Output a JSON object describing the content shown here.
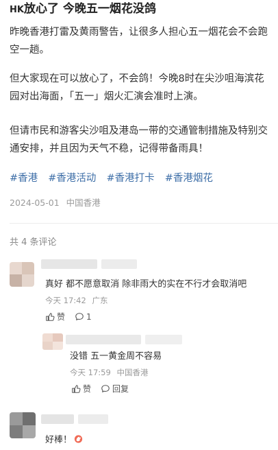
{
  "post": {
    "title_prefix": "HK",
    "title_main": "放心了 今晚五一烟花没鸽",
    "para1": "昨晚香港打雷及黄雨警告，让很多人担心五一烟花会不会跑空一趟。",
    "para2": "但大家现在可以放心了，不会鸽！今晚8时在尖沙咀海滨花园对出海面，「五一」烟火汇演会准时上演。",
    "para3": "但请市民和游客尖沙咀及港岛一带的交通管制措施及特别交通安排，并且因为天气不稳，记得带备雨具！",
    "tags": [
      "#香港",
      "#香港活动",
      "#香港打卡",
      "#香港烟花"
    ],
    "date": "2024-05-01",
    "location": "中国香港"
  },
  "comments": {
    "count_label": "共 4 条评论",
    "items": [
      {
        "text": "真好 都不愿意取消 除非雨大的实在不行才会取消吧",
        "time": "今天 17:42",
        "location": "广东",
        "like_label": "赞",
        "reply_count": "1"
      },
      {
        "text": "没错 五一黄金周不容易",
        "time": "今天 17:59",
        "location": "中国香港",
        "like_label": "赞",
        "reply_label": "回复"
      },
      {
        "text": "好棒！"
      }
    ]
  },
  "colors": {
    "tag": "#3d6ea7",
    "meta": "#9a9a9a",
    "text": "#333333",
    "title": "#222222"
  },
  "icons": [
    "thumb-up-icon",
    "comment-bubble-icon",
    "clap-emoji-icon"
  ]
}
